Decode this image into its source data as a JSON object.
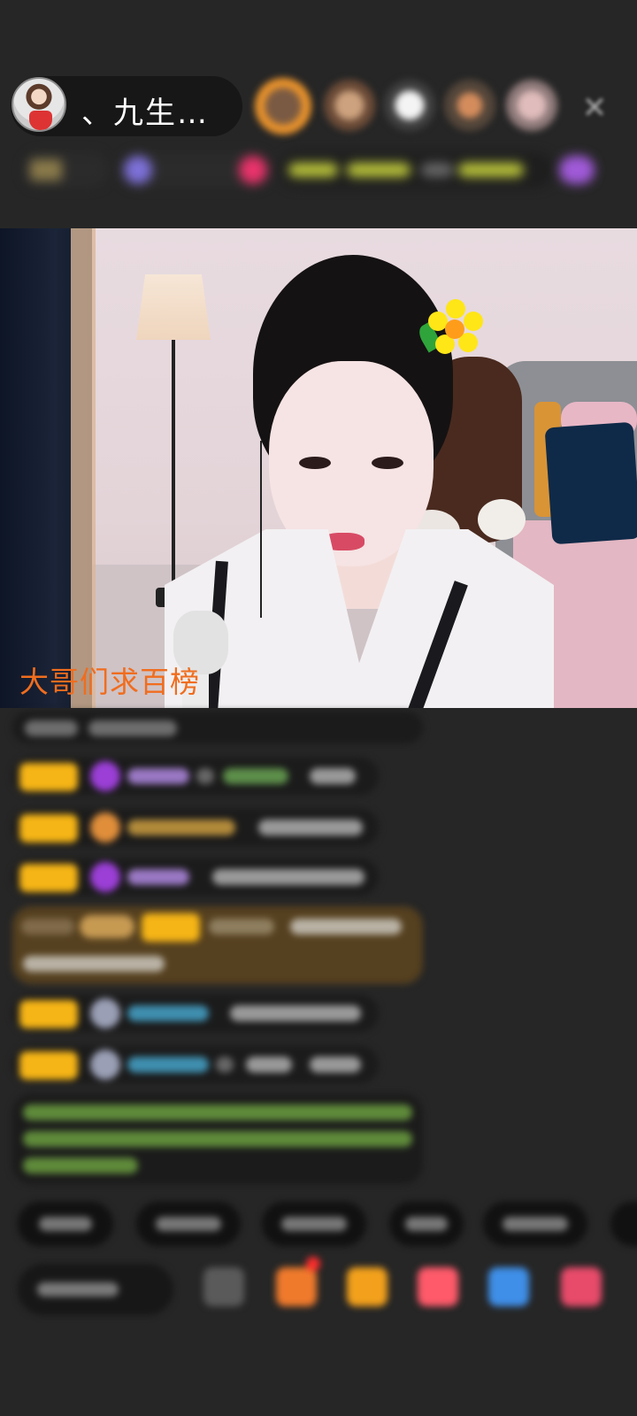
{
  "header": {
    "host_name": "、九生…",
    "close_icon": "close-icon"
  },
  "video": {
    "overlay_caption": "大哥们求百榜"
  },
  "colors": {
    "background": "#262626",
    "caption": "#f06d1e",
    "badge": "#f6b516",
    "gem": "#9b3fd6"
  }
}
